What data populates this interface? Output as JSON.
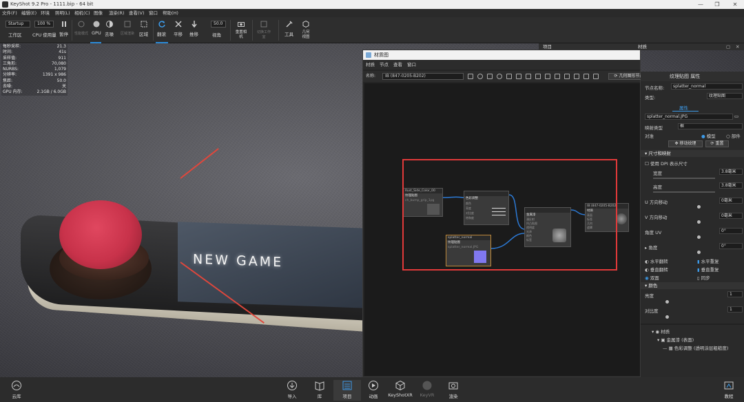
{
  "window": {
    "title": "KeyShot 9.2 Pro - 1111.bip - 64 bit",
    "controls": [
      "—",
      "❐",
      "✕"
    ]
  },
  "menu": [
    "文件(F)",
    "编辑(E)",
    "环境",
    "照明(L)",
    "相机(C)",
    "图像",
    "渲染(R)",
    "查看(V)",
    "窗口",
    "帮助(H)"
  ],
  "toolbar": {
    "workspace_value": "Startup",
    "workspace_label": "工作区",
    "cpu_value": "100 %",
    "cpu_label": "CPU 使用量",
    "pause": "暂停",
    "perf_mode": "性能模式",
    "gpu": "GPU",
    "denoise": "去噪",
    "region_render": "区域渲染",
    "region": "区域",
    "tumble": "翻滚",
    "pan": "平移",
    "dolly": "推移",
    "fov_value": "50.0",
    "fov_label": "视角",
    "reset_camera": "重置相机",
    "switch_workspace": "切换工作室",
    "tools": "工具",
    "geometry": "几何视图"
  },
  "stats": [
    {
      "k": "每秒采样:",
      "v": "21.3"
    },
    {
      "k": "时间:",
      "v": "41s"
    },
    {
      "k": "采样值:",
      "v": "911"
    },
    {
      "k": "三角形:",
      "v": "70,080"
    },
    {
      "k": "NURBS:",
      "v": "1,079"
    },
    {
      "k": "分辨率:",
      "v": "1391 x 986"
    },
    {
      "k": "焦距:",
      "v": "50.0"
    },
    {
      "k": "去噪:",
      "v": "关"
    },
    {
      "k": "GPU 内存:",
      "v": "2.1GB / 6.0GB"
    }
  ],
  "scene_text": "NEW GAME",
  "material_window": {
    "title": "材质图",
    "menu": [
      "材质",
      "节点",
      "查看",
      "窗口"
    ],
    "name_label": "名称:",
    "name_value": "IB (847-0205-B202)",
    "geo_node_btn": "几何图形节点"
  },
  "nodes": {
    "color_node": {
      "header": "Rust_Side_Color_00",
      "title": "纹理贴图",
      "sub": "ch_bump_grip_1pg"
    },
    "color_adjust": {
      "header": "",
      "title": "色彩调整",
      "ports": [
        "颜色",
        "亮度",
        "对比度",
        "饱和度",
        "色相"
      ]
    },
    "metal_mat": {
      "header": "",
      "title": "金属漆",
      "ports": [
        "漫反射",
        "凹凸贴图",
        "透明度",
        "光泽",
        "颜色",
        "标签"
      ]
    },
    "texture_node": {
      "header": "splatter_normal",
      "title": "纹理贴图",
      "sub": "splatter_normal.JPG"
    },
    "output": {
      "header": "IB (847-0205-B202)",
      "title": "材质",
      "ports": [
        "表面",
        "标签",
        "几何",
        "遮罩"
      ]
    }
  },
  "right_dock": {
    "tab1": "项目",
    "tab2": "材质"
  },
  "props": {
    "header": "纹理贴图 属性",
    "node_name_label": "节点名称:",
    "node_name_value": "splatter_normal",
    "type_label": "类型:",
    "type_value": "纹理贴图",
    "attr_tab": "属性",
    "file_value": "splatter_normal.JPG",
    "mapping_label": "映射类型",
    "mapping_value": "框",
    "align_label": "对准",
    "align_opt1": "模型",
    "align_opt2": "部件",
    "move_texture": "移动纹理",
    "reset": "重置",
    "size_section": "尺寸和映射",
    "use_dpi": "使用 DPI 表示尺寸",
    "width_label": "宽度",
    "width_value": "3.8毫米",
    "height_label": "高度",
    "height_value": "3.8毫米",
    "u_offset_label": "U 方向移动",
    "u_offset_value": "0毫米",
    "v_offset_label": "V 方向移动",
    "v_offset_value": "0毫米",
    "angle_uv_label": "角度 UV",
    "angle_uv_value": "0°",
    "angle_label": "角度",
    "angle_value": "0°",
    "flip_h": "水平翻转",
    "repeat_h": "水平重复",
    "flip_v": "垂直翻转",
    "repeat_v": "垂直重复",
    "both_sides": "双面",
    "sync": "同步",
    "color_section": "颜色",
    "brightness_label": "亮度",
    "brightness_value": "1",
    "contrast_label": "对比度",
    "contrast_value": "1",
    "tree_root": "材质",
    "tree_1": "金属漆 (表面)",
    "tree_2": "色彩调整 (透明涂层粗糙度)"
  },
  "bottom": {
    "cloud": "云库",
    "import": "导入",
    "library": "库",
    "project": "项目",
    "animation": "动画",
    "keyshotxr": "KeyShotXR",
    "render_dim": "KeyVR",
    "render": "渲染",
    "tutorial": "教程"
  },
  "colors": {
    "accent": "#2b8ad8",
    "highlight_box": "#e23a3a",
    "button_red": "#c8324a"
  }
}
